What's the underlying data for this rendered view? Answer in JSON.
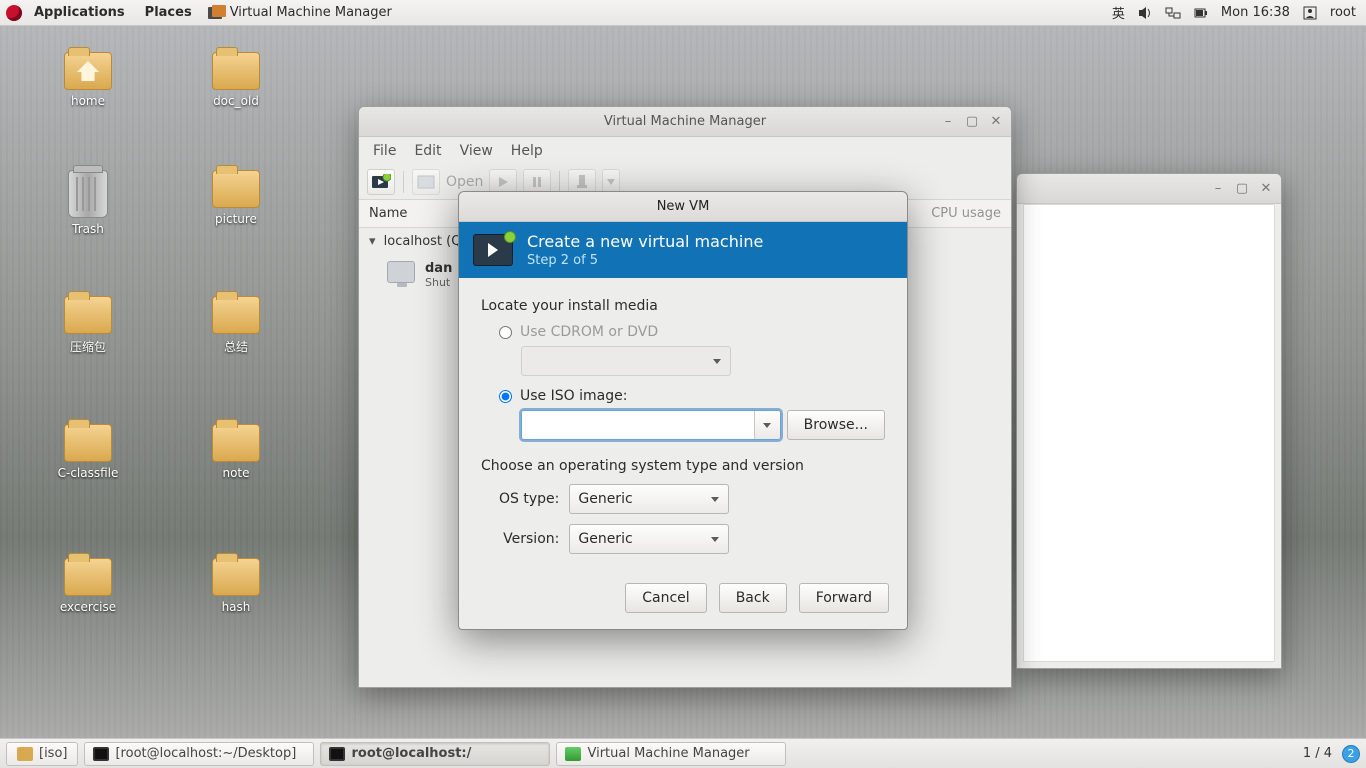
{
  "top_panel": {
    "applications": "Applications",
    "places": "Places",
    "active_app": "Virtual Machine Manager",
    "ime": "英",
    "clock": "Mon 16:38",
    "user": "root"
  },
  "desktop_icons": {
    "home": "home",
    "doc_old": "doc_old",
    "trash": "Trash",
    "picture": "picture",
    "yasuo": "压缩包",
    "zongjie": "总结",
    "cclass": "C-classfile",
    "note": "note",
    "excercise": "excercise",
    "hash": "hash"
  },
  "vmm_window": {
    "title": "Virtual Machine Manager",
    "menu": {
      "file": "File",
      "edit": "Edit",
      "view": "View",
      "help": "Help"
    },
    "toolbar": {
      "open": "Open"
    },
    "columns": {
      "name": "Name",
      "cpu": "CPU usage"
    },
    "connection": "localhost (QEMU)",
    "vm": {
      "name_partial": "dan",
      "state": "Shut"
    }
  },
  "new_vm": {
    "title": "New VM",
    "banner_title": "Create a new virtual machine",
    "banner_step": "Step 2 of 5",
    "locate_label": "Locate your install media",
    "use_cdrom": "Use CDROM or DVD",
    "use_iso": "Use ISO image:",
    "browse": "Browse...",
    "choose_os_label": "Choose an operating system type and version",
    "os_type_label": "OS type:",
    "os_type_value": "Generic",
    "version_label": "Version:",
    "version_value": "Generic",
    "cancel": "Cancel",
    "back": "Back",
    "forward": "Forward",
    "iso_path": ""
  },
  "taskbar": {
    "iso": "[iso]",
    "term1": "[root@localhost:~/Desktop]",
    "term2": "root@localhost:/",
    "vmm": "Virtual Machine Manager",
    "workspaces": "1 / 4",
    "badge": "2"
  }
}
